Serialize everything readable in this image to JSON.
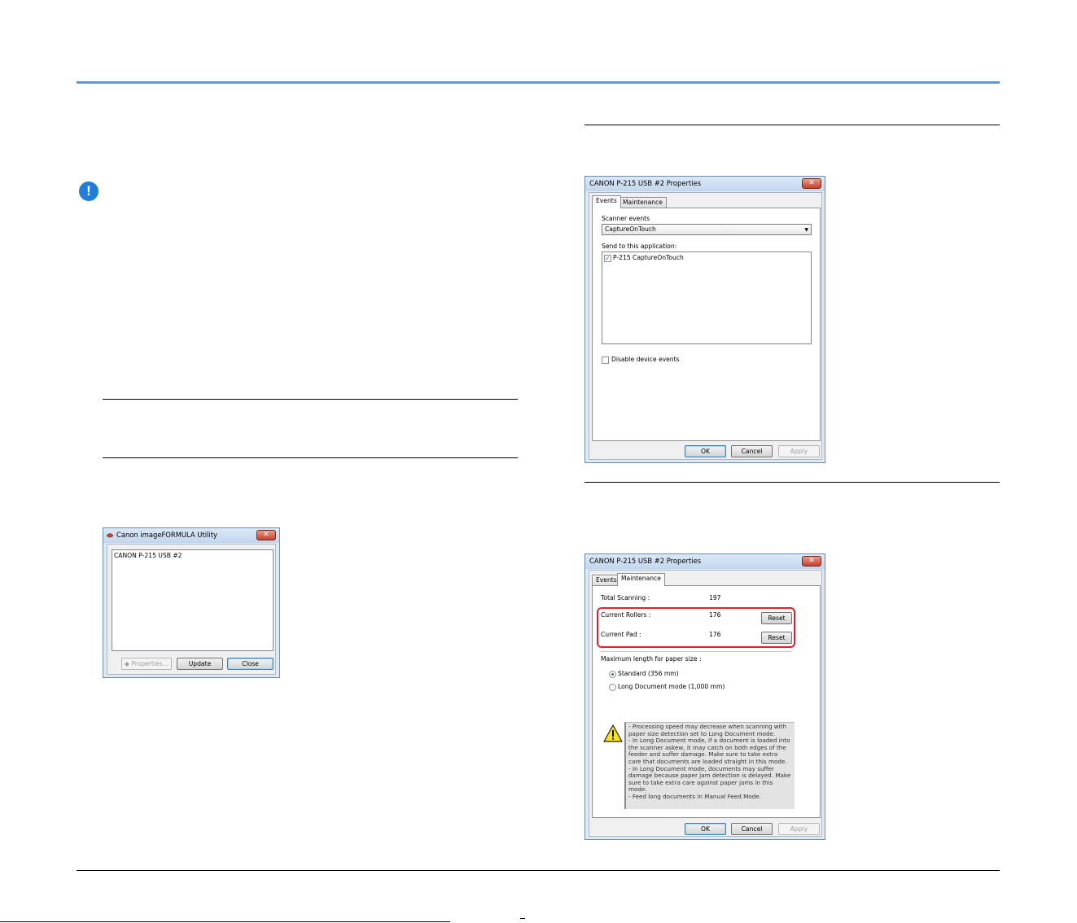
{
  "utility_dialog": {
    "title": "Canon imageFORMULA Utility",
    "device_item": "CANON P-215 USB #2",
    "buttons": {
      "properties": "Properties...",
      "update": "Update",
      "close": "Close"
    }
  },
  "events_dialog": {
    "title": "CANON P-215 USB #2 Properties",
    "tabs": {
      "events": "Events",
      "maintenance": "Maintenance"
    },
    "scanner_events_label": "Scanner events",
    "scanner_events_value": "CaptureOnTouch",
    "send_to_label": "Send to this application:",
    "app_item": "P-215 CaptureOnTouch",
    "disable_label": "Disable device events",
    "buttons": {
      "ok": "OK",
      "cancel": "Cancel",
      "apply": "Apply"
    }
  },
  "maintenance_dialog": {
    "title": "CANON P-215 USB #2 Properties",
    "tabs": {
      "events": "Events",
      "maintenance": "Maintenance"
    },
    "total_label": "Total Scanning :",
    "total_value": "197",
    "rollers_label": "Current Rollers :",
    "rollers_value": "176",
    "pad_label": "Current Pad :",
    "pad_value": "176",
    "reset_label": "Reset",
    "max_length_label": "Maximum length for paper size :",
    "radio_standard": "Standard (356 mm)",
    "radio_long": "Long Document mode (1,000 mm)",
    "warning_text": "- Processing speed may decrease when scanning with paper size detection set to Long Document mode.\n- In Long Document mode, if a document is loaded into the scanner askew, it may catch on both edges of the feeder and suffer damage. Make sure to take extra care that documents are loaded straight in this mode.\n- In Long Document mode, documents may suffer damage because paper jam detection is delayed. Make sure to take extra care against paper jams in this mode.\n- Feed long documents in Manual Feed Mode.",
    "buttons": {
      "ok": "OK",
      "cancel": "Cancel",
      "apply": "Apply"
    }
  },
  "colors": {
    "header_rule": "#2f76c2",
    "important_icon": "#1f7fd8",
    "highlight_frame": "#e0202c"
  }
}
